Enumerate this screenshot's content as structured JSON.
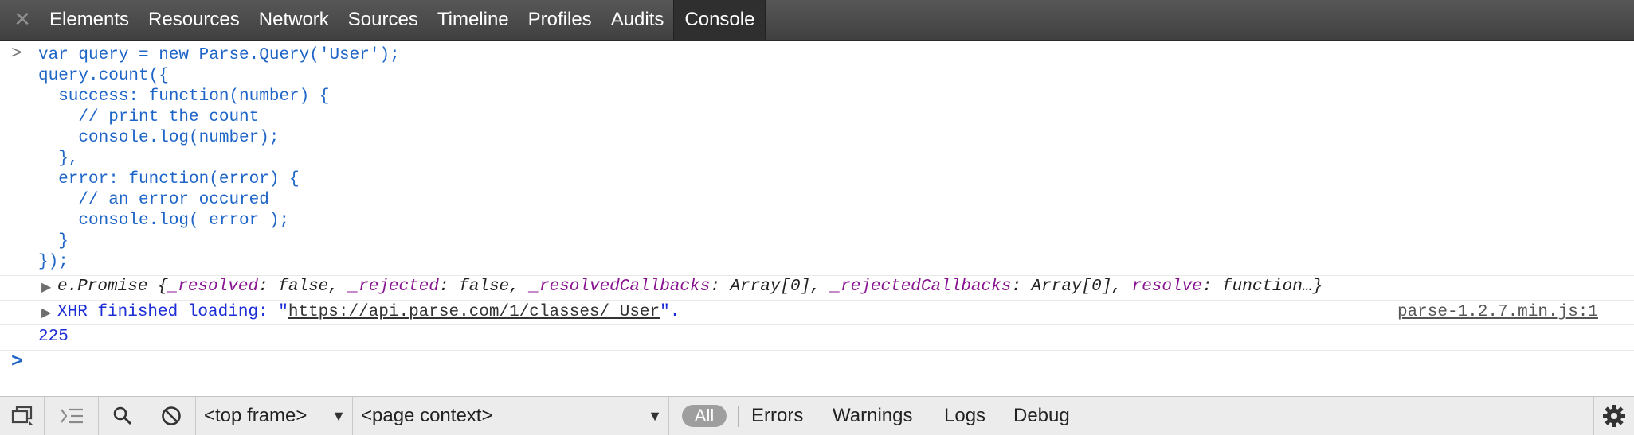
{
  "toolbar": {
    "close_glyph": "✕",
    "tabs": [
      {
        "label": "Elements"
      },
      {
        "label": "Resources"
      },
      {
        "label": "Network"
      },
      {
        "label": "Sources"
      },
      {
        "label": "Timeline"
      },
      {
        "label": "Profiles"
      },
      {
        "label": "Audits"
      },
      {
        "label": "Console",
        "active": true
      }
    ]
  },
  "console": {
    "prompt_symbol": ">",
    "code": "var query = new Parse.Query('User');\nquery.count({\n  success: function(number) {\n    // print the count\n    console.log(number);\n  },\n  error: function(error) {\n    // an error occured\n    console.log( error );\n  }\n});",
    "promise_row": {
      "disclosure": "▶",
      "class_name": "e.Promise {",
      "props": [
        {
          "key": "_resolved",
          "value": "false"
        },
        {
          "key": "_rejected",
          "value": "false"
        },
        {
          "key": "_resolvedCallbacks",
          "value": "Array[0]"
        },
        {
          "key": "_rejectedCallbacks",
          "value": "Array[0]"
        },
        {
          "key": "resolve",
          "value": "function…}"
        }
      ]
    },
    "xhr_row": {
      "disclosure": "▶",
      "prefix": "XHR finished loading: \"",
      "url": "https://api.parse.com/1/classes/_User",
      "suffix": "\".",
      "source": "parse-1.2.7.min.js:1"
    },
    "result": "225",
    "input_prompt": ">"
  },
  "bottombar": {
    "frame_select": "<top frame>",
    "context_select": "<page context>",
    "filters": [
      "All",
      "Errors",
      "Warnings",
      "Logs",
      "Debug"
    ]
  },
  "colors": {
    "code": "#1e65c7",
    "property_key": "#881391",
    "xhr_text": "#1b2dd6",
    "tabbar": "#4a4a4a"
  }
}
